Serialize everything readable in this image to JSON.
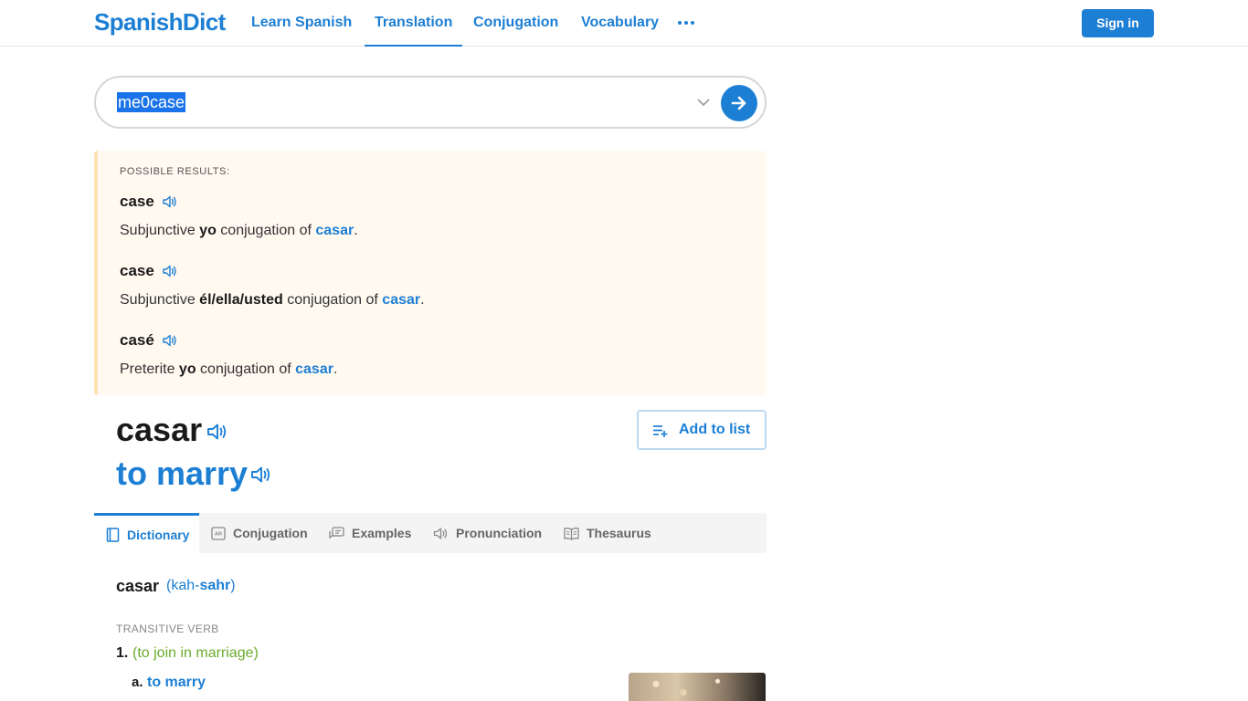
{
  "header": {
    "logo": "SpanishDict",
    "nav": [
      {
        "label": "Learn Spanish",
        "active": false
      },
      {
        "label": "Translation",
        "active": true
      },
      {
        "label": "Conjugation",
        "active": false
      },
      {
        "label": "Vocabulary",
        "active": false
      }
    ],
    "more_icon": "ellipsis-icon",
    "signin_label": "Sign in"
  },
  "search": {
    "value": "me0case",
    "caret_icon": "chevron-down-icon",
    "go_icon": "arrow-right-icon"
  },
  "possible_results": {
    "title": "POSSIBLE RESULTS:",
    "items": [
      {
        "word": "case",
        "desc_pre": "Subjunctive ",
        "desc_bold": "yo",
        "desc_mid": " conjugation of ",
        "desc_link": "casar",
        "desc_end": "."
      },
      {
        "word": "case",
        "desc_pre": "Subjunctive ",
        "desc_bold": "él/ella/usted",
        "desc_mid": " conjugation of ",
        "desc_link": "casar",
        "desc_end": "."
      },
      {
        "word": "casé",
        "desc_pre": "Preterite ",
        "desc_bold": "yo",
        "desc_mid": " conjugation of ",
        "desc_link": "casar",
        "desc_end": "."
      }
    ]
  },
  "headword": {
    "word": "casar",
    "translation": "to marry",
    "add_to_list_label": "Add to list"
  },
  "tabs": [
    {
      "label": "Dictionary",
      "icon": "book-icon",
      "active": true
    },
    {
      "label": "Conjugation",
      "icon": "conjugation-icon",
      "active": false
    },
    {
      "label": "Examples",
      "icon": "speech-bubbles-icon",
      "active": false
    },
    {
      "label": "Pronunciation",
      "icon": "speaker-icon",
      "active": false
    },
    {
      "label": "Thesaurus",
      "icon": "open-book-icon",
      "active": false
    }
  ],
  "dictionary": {
    "word": "casar",
    "pron_open": "(kah-",
    "pron_bold": "sahr",
    "pron_close": ")",
    "pos": "TRANSITIVE VERB",
    "sense_number": "1.",
    "sense_context": "(to join in marriage)",
    "sub_letter": "a.",
    "sub_translation": "to marry"
  },
  "colors": {
    "brand": "#1d7fd4",
    "context_green": "#6aab2e",
    "results_bg": "#fff9f0"
  }
}
